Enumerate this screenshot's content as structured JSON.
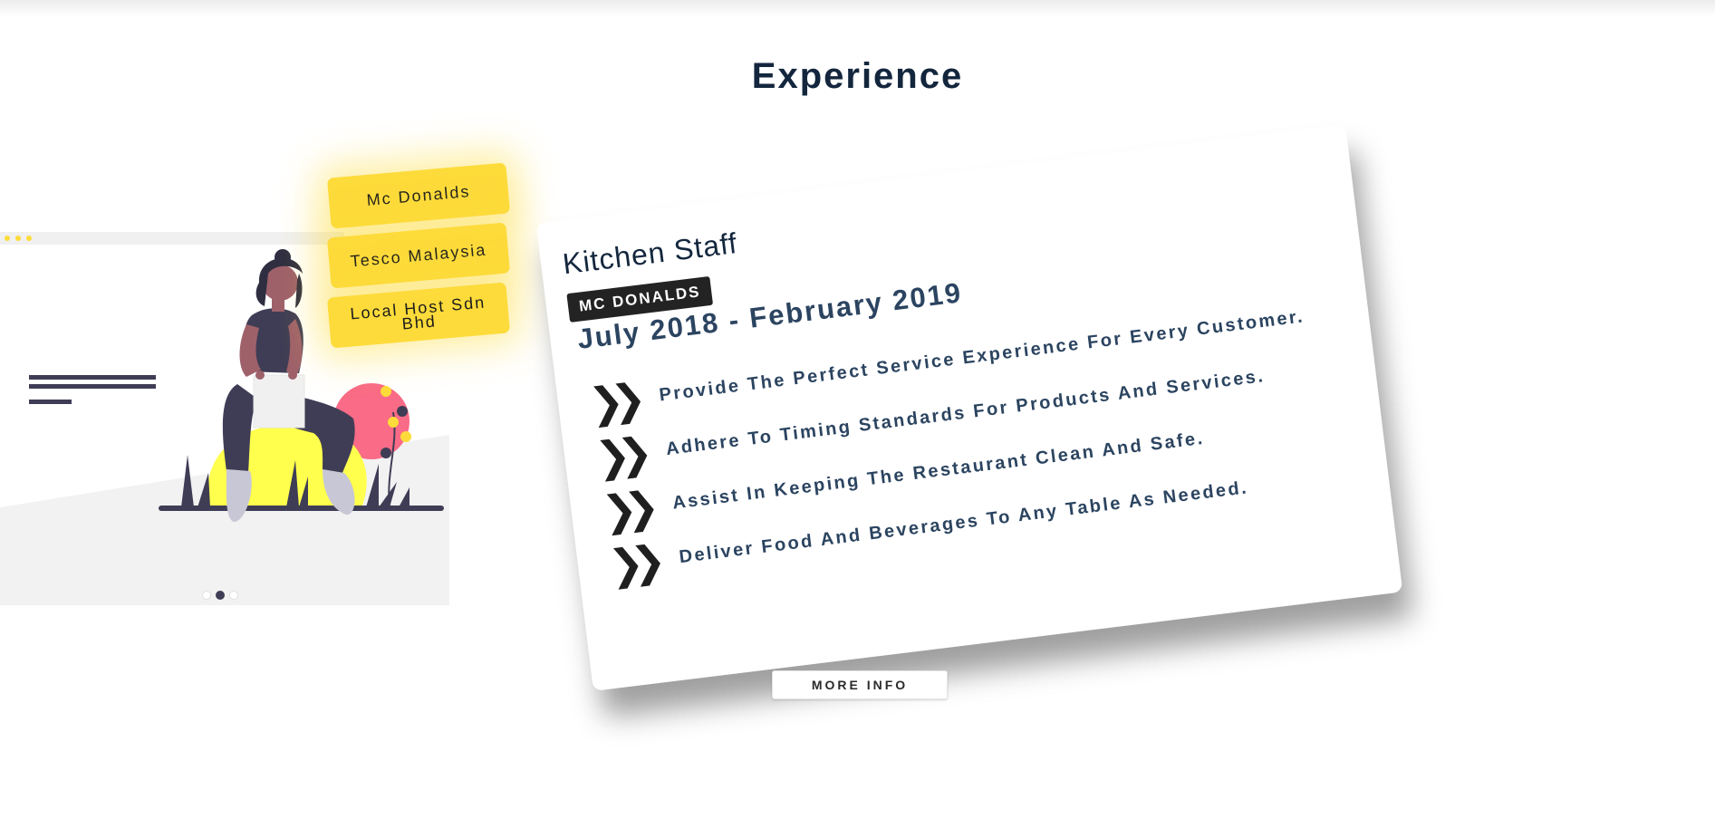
{
  "section": {
    "title": "Experience"
  },
  "companies": [
    {
      "label": "Mc Donalds"
    },
    {
      "label": "Tesco Malaysia"
    },
    {
      "label": "Local Host Sdn Bhd"
    }
  ],
  "carousel": {
    "dots": 3,
    "active_index": 1
  },
  "job": {
    "title": "Kitchen Staff",
    "company": "MC DONALDS",
    "period": "July 2018 - February 2019",
    "duties": [
      "Provide The Perfect Service Experience For Every Customer.",
      "Adhere To Timing Standards For Products And Services.",
      "Assist In Keeping The Restaurant Clean And Safe.",
      "Deliver Food And Beverages To Any Table As Needed."
    ],
    "duty_icon": "double-chevron-right-icon"
  },
  "more_info": {
    "label": "MORE INFO"
  },
  "colors": {
    "accent_yellow": "#fddb3a",
    "heading": "#13263d",
    "body_text": "#2b4460",
    "badge_bg": "#232323",
    "illustration_dark": "#3f3d56",
    "illustration_pink": "#f96b86"
  }
}
